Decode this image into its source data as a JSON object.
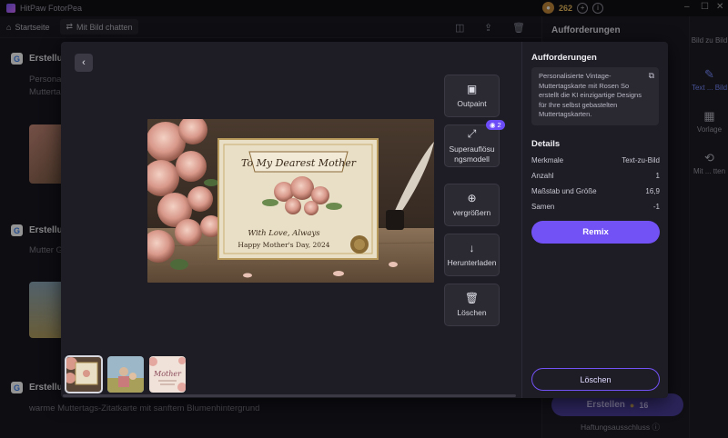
{
  "app": {
    "title": "HitPaw FotorPea",
    "credits": "262",
    "window_min": "–",
    "window_max": "☐",
    "window_close": "✕"
  },
  "toolbar": {
    "home_label": "Startseite",
    "chat_label": "Mit Bild chatten"
  },
  "background": {
    "sections": [
      {
        "heading": "Erstellun",
        "text1": "Personali",
        "text2": "Mutterta"
      },
      {
        "heading": "Erstellun",
        "text1": "Mutter G"
      },
      {
        "heading": "Erstellun",
        "text1": "warme Muttertags-Zitatkarte mit sanftem Blumenhintergrund"
      }
    ],
    "right_panel_title": "Aufforderungen",
    "create_button": "Erstellen",
    "create_cost": "16",
    "disclaimer": "Haftungsausschluss",
    "sidebar": [
      {
        "label": "Bild zu Bild"
      },
      {
        "label": "Text ... Bild"
      },
      {
        "label": "Vorlage"
      },
      {
        "label": "Mit ... tten"
      }
    ]
  },
  "modal": {
    "image": {
      "card_title": "To My Dearest Mother",
      "card_line1": "With Love, Always",
      "card_line2": "Happy Mother's Day, 2024"
    },
    "actions": [
      {
        "label": "Outpaint",
        "icon": "outpaint-icon"
      },
      {
        "label": "Superauflösungsmodell",
        "icon": "expand-icon",
        "badge": "2"
      },
      {
        "label": "vergrößern",
        "icon": "zoom-in-icon"
      },
      {
        "label": "Herunterladen",
        "icon": "download-icon"
      },
      {
        "label": "Löschen",
        "icon": "trash-icon"
      }
    ],
    "panel": {
      "title": "Aufforderungen",
      "prompt": "Personalisierte Vintage-Muttertagskarte mit Rosen So erstellt die KI einzigartige Designs für Ihre selbst gebastelten Muttertagskarten.",
      "details_title": "Details",
      "details": [
        {
          "key": "Merkmale",
          "value": "Text-zu-Bild"
        },
        {
          "key": "Anzahl",
          "value": "1"
        },
        {
          "key": "Maßstab und Größe",
          "value": "16,9"
        },
        {
          "key": "Samen",
          "value": "-1"
        }
      ],
      "remix_label": "Remix",
      "delete_label": "Löschen"
    },
    "thumbnail_mother_text": "Mother"
  }
}
